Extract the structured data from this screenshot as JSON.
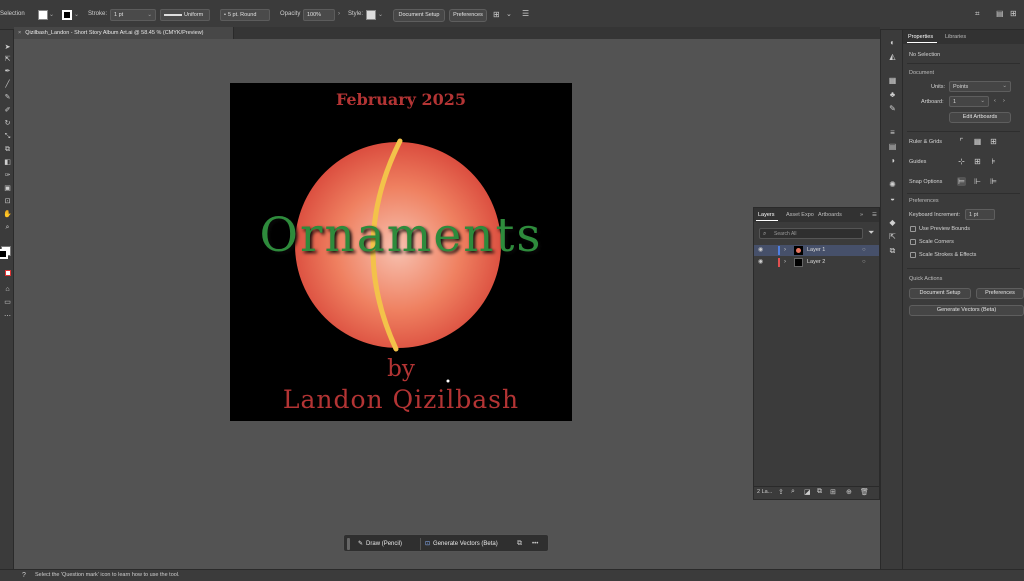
{
  "control_bar": {
    "selection_label": "Selection",
    "stroke_label": "Stroke:",
    "stroke_weight": "1 pt",
    "profile": "Uniform",
    "brush": "5 pt. Round",
    "opacity_label": "Opacity",
    "opacity_value": "100%",
    "style_label": "Style:",
    "document_setup": "Document Setup",
    "preferences": "Preferences"
  },
  "document_tab": {
    "title": "Qizilbash_Landon - Short Story Album Art.ai @ 58.45 % (CMYK/Preview)"
  },
  "artwork": {
    "date": "February 2025",
    "title": "Ornaments",
    "by": "by",
    "author": "Landon Qizilbash",
    "colors": {
      "background": "#000000",
      "text_red": "#b33434",
      "title_green": "#2e8b3c",
      "ornament_light": "#f7c1b0",
      "ornament_dark": "#d8463a",
      "seam_gold": "#f3c24a"
    }
  },
  "layers_panel": {
    "tabs": [
      "Layers",
      "Asset Expo",
      "Artboards"
    ],
    "search_placeholder": "Search All",
    "layers": [
      {
        "name": "Layer 1",
        "color": "#4f7fe0"
      },
      {
        "name": "Layer 2",
        "color": "#e05050"
      }
    ],
    "footer_count": "2 La..."
  },
  "properties": {
    "tabs": [
      "Properties",
      "Libraries"
    ],
    "no_selection": "No Selection",
    "document_header": "Document",
    "units_label": "Units:",
    "units_value": "Points",
    "artboard_label": "Artboard:",
    "artboard_value": "1",
    "edit_artboards": "Edit Artboards",
    "ruler_grids": "Ruler & Grids",
    "guides": "Guides",
    "snap_options": "Snap Options",
    "preferences_header": "Preferences",
    "keyboard_increment_label": "Keyboard Increment:",
    "keyboard_increment_value": "1 pt",
    "use_preview_bounds": "Use Preview Bounds",
    "scale_corners": "Scale Corners",
    "scale_strokes": "Scale Strokes & Effects",
    "quick_actions": "Quick Actions",
    "document_setup": "Document Setup",
    "preferences": "Preferences",
    "generate_vectors": "Generate Vectors (Beta)"
  },
  "contextual_bar": {
    "draw": "Draw (Pencil)",
    "generate": "Generate Vectors (Beta)",
    "more": "•••"
  },
  "status": {
    "hint": "Select the 'Question mark' icon to learn how to use the tool."
  }
}
